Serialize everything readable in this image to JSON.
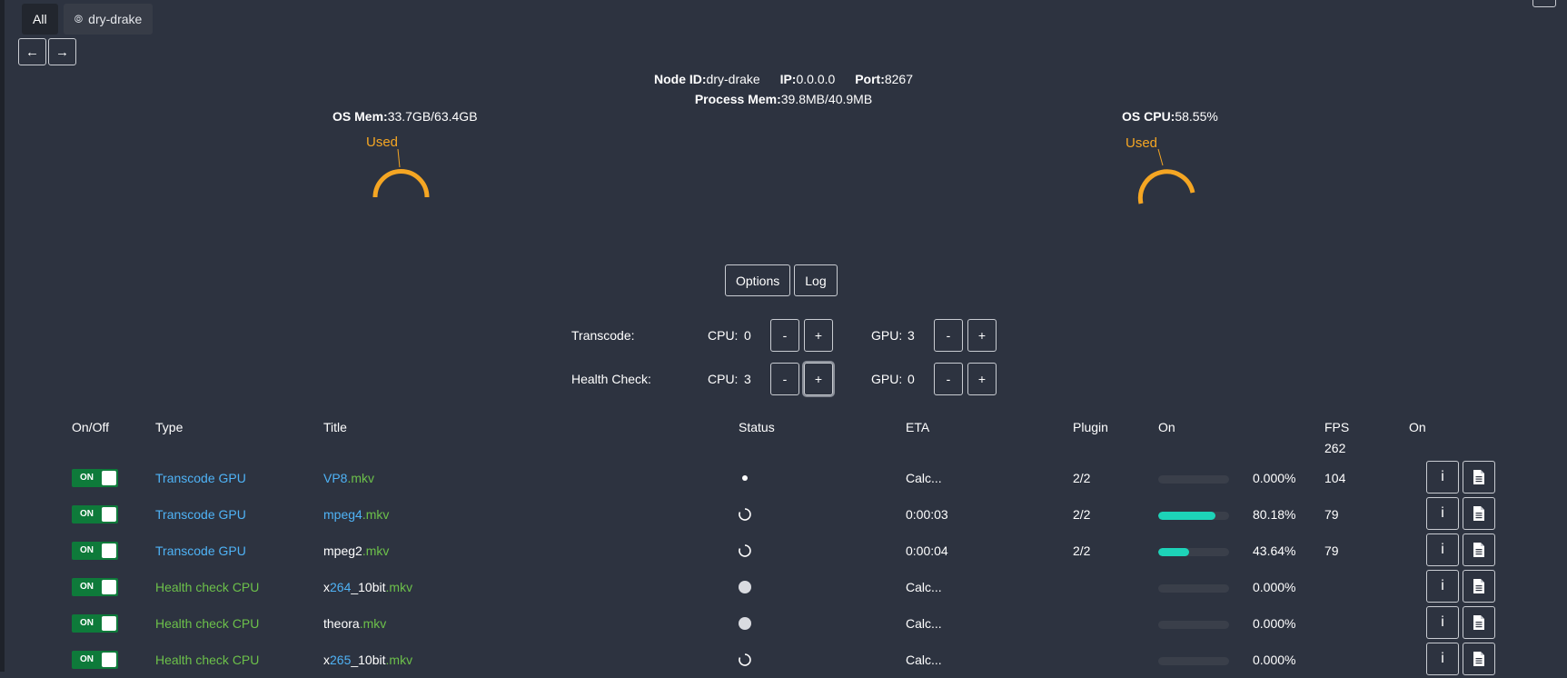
{
  "tabs": [
    {
      "label": "All"
    },
    {
      "label": "dry-drake",
      "icon": "broadcast-icon"
    }
  ],
  "nav": {
    "back_label": "←",
    "forward_label": "→"
  },
  "node": {
    "id_label": "Node ID:",
    "id_value": "dry-drake",
    "ip_label": "IP:",
    "ip_value": "0.0.0.0",
    "port_label": "Port:",
    "port_value": "8267",
    "process_mem_label": "Process Mem:",
    "process_mem_value": "39.8MB/40.9MB"
  },
  "os_mem": {
    "label": "OS Mem:",
    "value": "33.7GB/63.4GB",
    "used_label": "Used",
    "used_fraction": 0.53
  },
  "os_cpu": {
    "label": "OS CPU:",
    "value": "58.55%",
    "used_label": "Used",
    "used_fraction": 0.5855
  },
  "buttons": {
    "options": "Options",
    "log": "Log"
  },
  "workers": [
    {
      "label": "Transcode:",
      "cpu_label": "CPU:",
      "cpu_value": "0",
      "gpu_label": "GPU:",
      "gpu_value": "3",
      "minus": "-",
      "plus": "+"
    },
    {
      "label": "Health Check:",
      "cpu_label": "CPU:",
      "cpu_value": "3",
      "gpu_label": "GPU:",
      "gpu_value": "0",
      "minus": "-",
      "plus": "+"
    }
  ],
  "table": {
    "headers": {
      "onoff": "On/Off",
      "type": "Type",
      "title": "Title",
      "status": "Status",
      "eta": "ETA",
      "plugin": "Plugin",
      "on": "On",
      "fps": "FPS",
      "on2": "On"
    },
    "fps_total": "262",
    "toggle_label": "ON",
    "info_label": "i",
    "rows": [
      {
        "type": "Transcode GPU",
        "type_color": "blue",
        "title_parts": [
          {
            "t": "VP8",
            "c": "blue"
          },
          {
            "t": ".mkv",
            "c": "green"
          }
        ],
        "status": "dot",
        "eta": "Calc...",
        "plugin": "2/2",
        "progress": 0.0,
        "percent": "0.000%",
        "fps": "104"
      },
      {
        "type": "Transcode GPU",
        "type_color": "blue",
        "title_parts": [
          {
            "t": "mpeg4",
            "c": "blue"
          },
          {
            "t": ".mkv",
            "c": "green"
          }
        ],
        "status": "spinner",
        "eta": "0:00:03",
        "plugin": "2/2",
        "progress": 0.8018,
        "percent": "80.18%",
        "fps": "79"
      },
      {
        "type": "Transcode GPU",
        "type_color": "blue",
        "title_parts": [
          {
            "t": "mpeg2",
            "c": "white"
          },
          {
            "t": ".mkv",
            "c": "green"
          }
        ],
        "status": "spinner",
        "eta": "0:00:04",
        "plugin": "2/2",
        "progress": 0.4364,
        "percent": "43.64%",
        "fps": "79"
      },
      {
        "type": "Health check CPU",
        "type_color": "green",
        "title_parts": [
          {
            "t": "x",
            "c": "white"
          },
          {
            "t": "264",
            "c": "blue"
          },
          {
            "t": "_10bit",
            "c": "white"
          },
          {
            "t": ".mkv",
            "c": "green"
          }
        ],
        "status": "circle",
        "eta": "Calc...",
        "plugin": "",
        "progress": 0.0,
        "percent": "0.000%",
        "fps": ""
      },
      {
        "type": "Health check CPU",
        "type_color": "green",
        "title_parts": [
          {
            "t": "theora",
            "c": "white"
          },
          {
            "t": ".mkv",
            "c": "green"
          }
        ],
        "status": "circle",
        "eta": "Calc...",
        "plugin": "",
        "progress": 0.0,
        "percent": "0.000%",
        "fps": ""
      },
      {
        "type": "Health check CPU",
        "type_color": "green",
        "title_parts": [
          {
            "t": "x",
            "c": "white"
          },
          {
            "t": "265",
            "c": "blue"
          },
          {
            "t": "_10bit",
            "c": "white"
          },
          {
            "t": ".mkv",
            "c": "green"
          }
        ],
        "status": "spinner",
        "eta": "Calc...",
        "plugin": "",
        "progress": 0.0,
        "percent": "0.000%",
        "fps": ""
      }
    ]
  }
}
